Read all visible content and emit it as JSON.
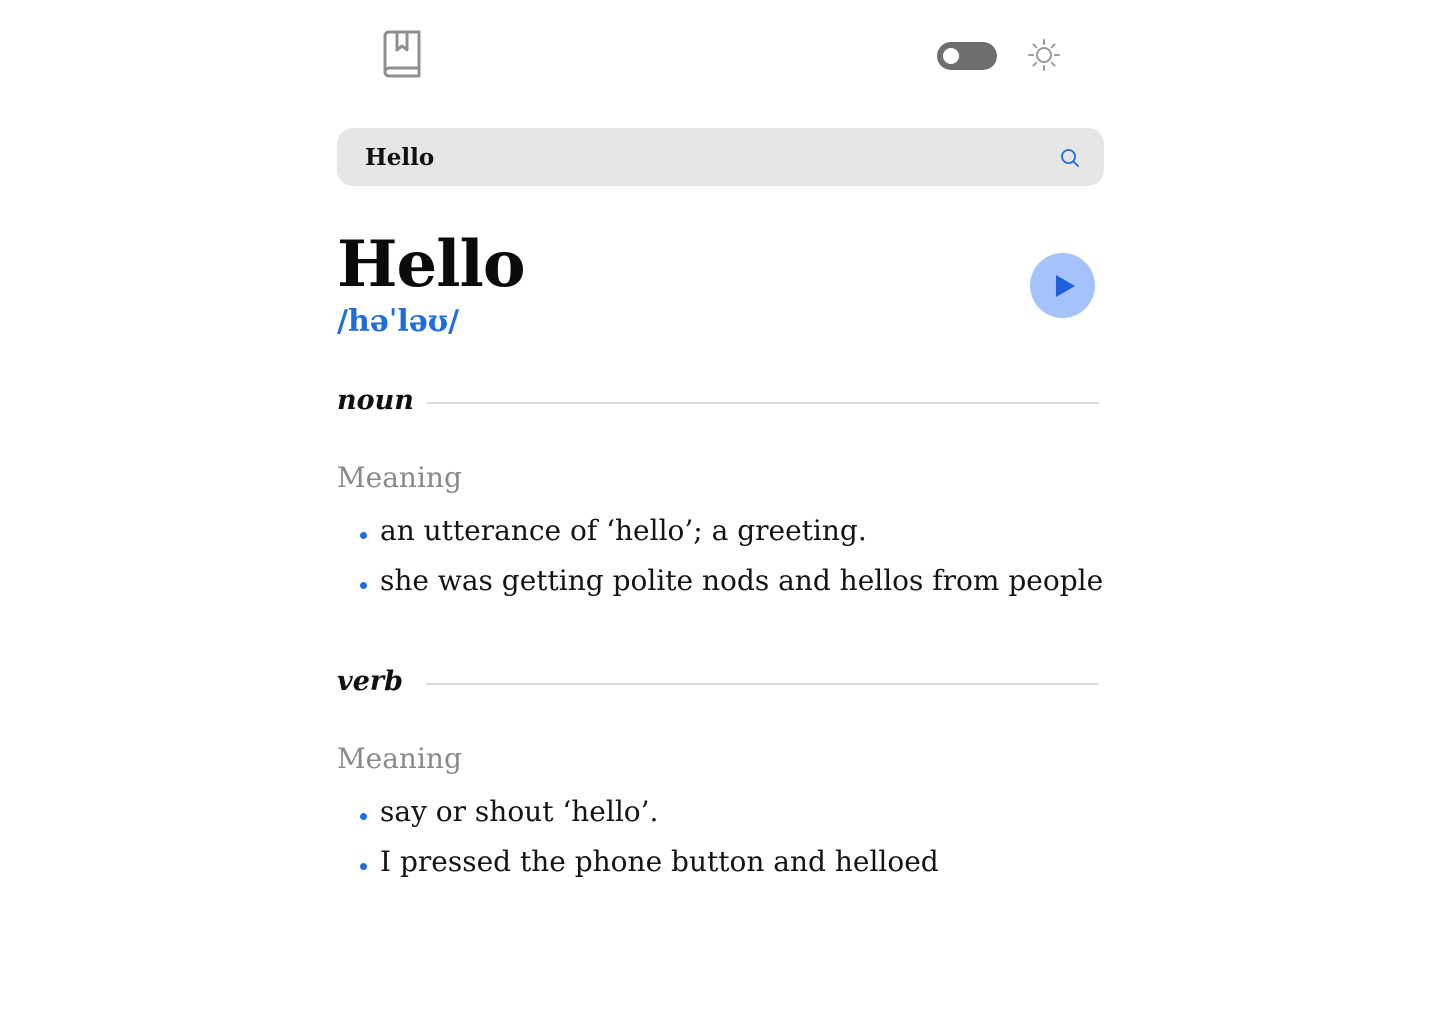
{
  "header": {
    "logo_icon": "book-bookmark-icon",
    "theme_toggle_state": "off",
    "theme_icon": "sun-icon"
  },
  "search": {
    "value": "Hello",
    "placeholder": "",
    "button_icon": "search-icon"
  },
  "entry": {
    "word": "Hello",
    "phonetic": "/həˈləʊ/",
    "play_icon": "play-icon"
  },
  "meanings": [
    {
      "part_of_speech": "noun",
      "meaning_label": "Meaning",
      "definitions": [
        "an utterance of ‘hello’; a greeting.",
        "she was getting polite nods and hellos from people"
      ]
    },
    {
      "part_of_speech": "verb",
      "meaning_label": "Meaning",
      "definitions": [
        "say or shout ‘hello’.",
        "I pressed the phone button and helloed"
      ]
    }
  ],
  "colors": {
    "accent": "#1f6ce0",
    "play_button_bg": "#a4c3fb",
    "search_bg": "#e6e6e6",
    "toggle_bg": "#6e6e6e",
    "muted_text": "#8a8a8a",
    "divider": "#dcdcdc"
  }
}
